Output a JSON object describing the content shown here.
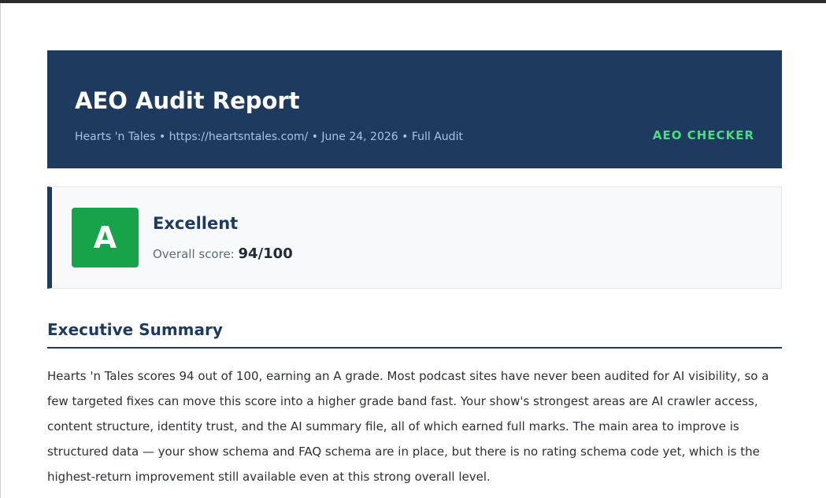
{
  "header": {
    "title": "AEO Audit Report",
    "meta": "Hearts 'n Tales • https://heartsntales.com/ • June 24, 2026 • Full Audit",
    "brand": "AEO CHECKER"
  },
  "score": {
    "grade": "A",
    "label": "Excellent",
    "overall_label": "Overall score:",
    "overall_value": "94/100"
  },
  "executive_summary": {
    "title": "Executive Summary",
    "text": "Hearts 'n Tales scores 94 out of 100, earning an A grade. Most podcast sites have never been audited for AI visibility, so a few targeted fixes can move this score into a higher grade band fast. Your show's strongest areas are AI crawler access, content structure, identity trust, and the AI summary file, all of which earned full marks. The main area to improve is structured data — your show schema and FAQ schema are in place, but there is no rating schema code yet, which is the highest-return improvement still available even at this strong overall level."
  },
  "colors": {
    "header_bg": "#1e3a5f",
    "brand": "#4ade80",
    "grade_bg": "#16a34a",
    "accent": "#1e3a5f"
  }
}
